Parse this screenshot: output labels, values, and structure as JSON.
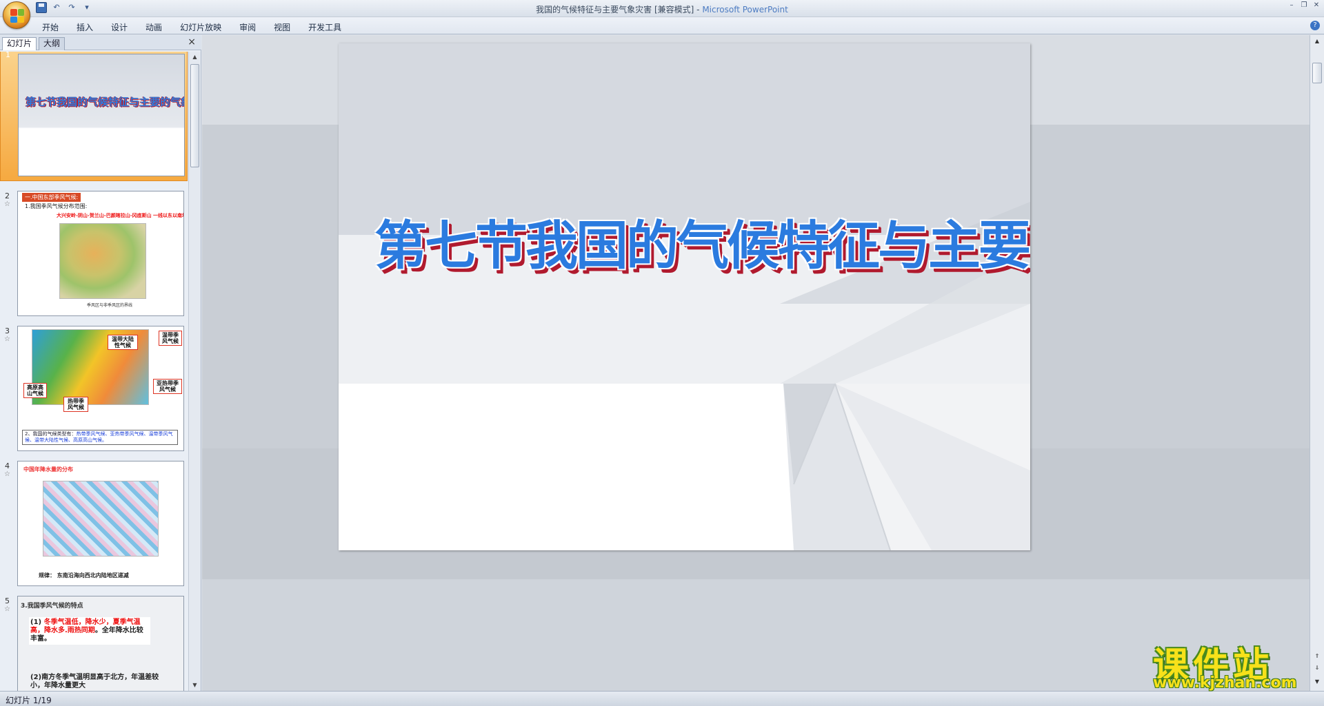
{
  "window": {
    "title_doc": "我国的气候特征与主要气象灾害 [兼容模式]",
    "title_sep": " - ",
    "title_app": "Microsoft PowerPoint"
  },
  "ribbon": {
    "tabs": [
      "开始",
      "插入",
      "设计",
      "动画",
      "幻灯片放映",
      "审阅",
      "视图",
      "开发工具"
    ]
  },
  "panel": {
    "tabs": [
      "幻灯片",
      "大纲"
    ],
    "close": "×"
  },
  "thumbnails": {
    "numbers": [
      "1",
      "2",
      "3",
      "4",
      "5"
    ],
    "slide1_title": "第七节我国的气候特征与主要的气象灾害",
    "slide2_header": "一.中国东部季风气候:",
    "slide2_line1": "1.我国季风气候分布范围:",
    "slide2_line2": "大兴安岭-阴山-贺兰山-巴颜喀拉山-冈底斯山 一线以东以南地区",
    "slide2_caption": "季风区与非季风区的界线",
    "slide3_labels": [
      "温带大陆性气候",
      "温带季风气候",
      "高原高山气候",
      "亚热带季风气候",
      "热带季风气候"
    ],
    "slide3_text_a": "2、我国的气候类型有：",
    "slide3_text_b": "热带季风气候、亚热带季风气候、温带季风气候、温带大陆性气候、高原高山气候。",
    "slide4_title": "中国年降水量的分布",
    "slide4_note": "规律： 东南沿海向西北内陆地区递减",
    "slide5_head": "3.我国季风气候的特点",
    "slide5_p1_a": "(1)",
    "slide5_p1_b": "冬季气温低，降水少，夏季气温高，降水多.雨热同期",
    "slide5_p1_c": "。全年降水比较丰富。",
    "slide5_p2": "(2)南方冬季气温明显高于北方，年温差较小，年降水量更大"
  },
  "slide": {
    "title": "第七节我国的气候特征与主要的气象灾害"
  },
  "status": {
    "slide_counter": "幻灯片 1/19"
  },
  "watermark": {
    "title": "课件站",
    "url": "www.kjzhan.com"
  },
  "colors": {
    "title_blue": "#2b7bdf",
    "title_shadow_red": "#b01a2e",
    "selection_orange": "#f6a940",
    "watermark_yellow": "#f7e11a"
  }
}
